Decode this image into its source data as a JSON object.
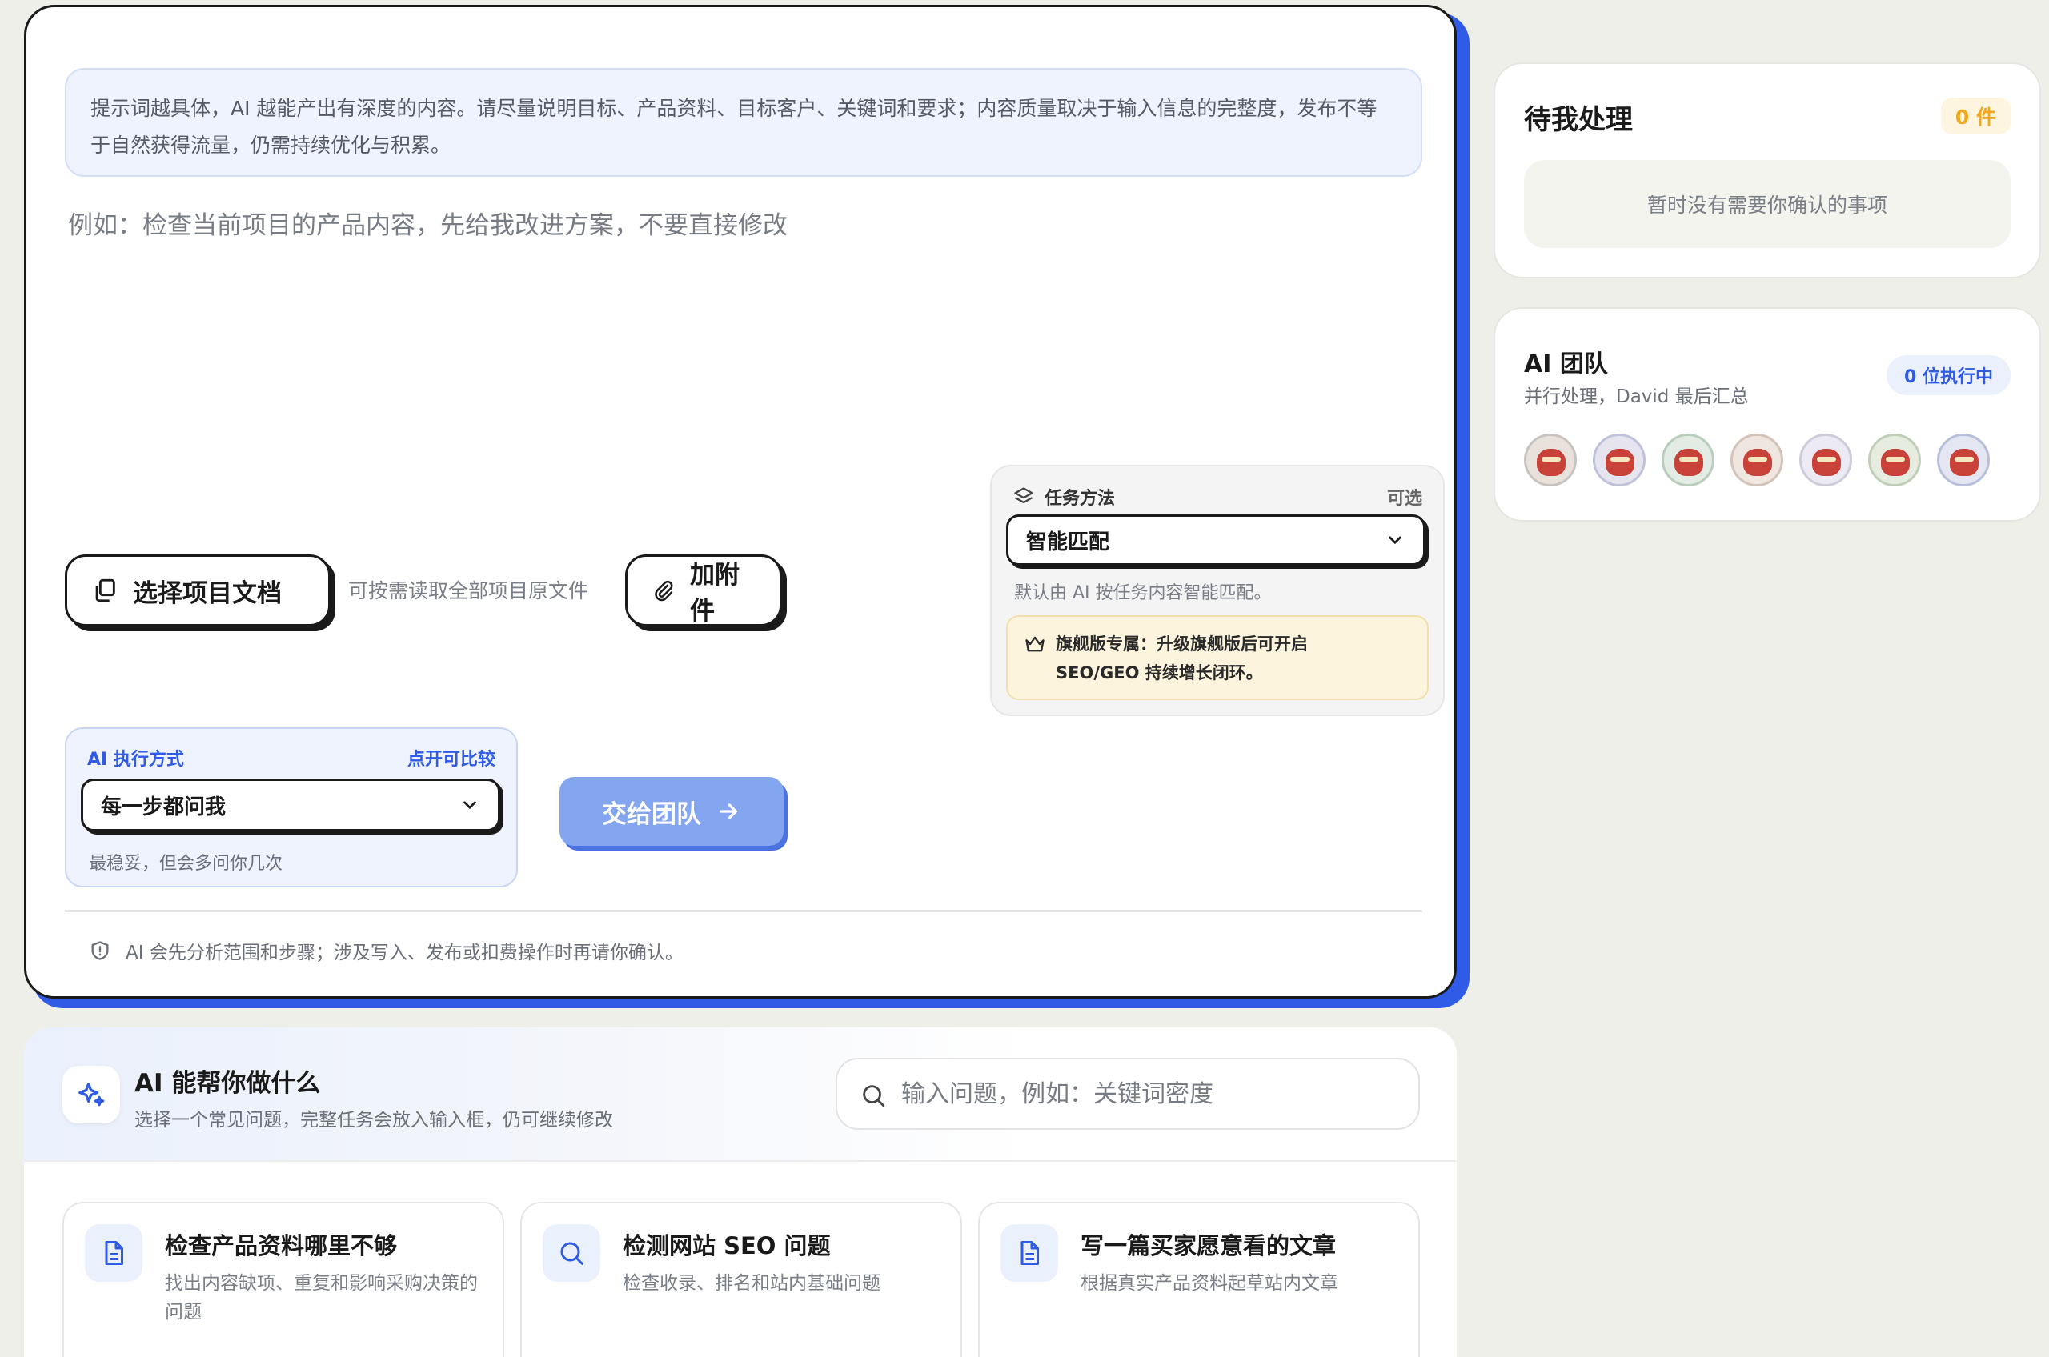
{
  "composer": {
    "hint": "提示词越具体，AI 越能产出有深度的内容。请尽量说明目标、产品资料、目标客户、关键词和要求；内容质量取决于输入信息的完整度，发布不等于自然获得流量，仍需持续优化与积累。",
    "prompt_placeholder": "例如：检查当前项目的产品内容，先给我改进方案，不要直接修改",
    "select_doc_label": "选择项目文档",
    "select_doc_hint": "可按需读取全部项目原文件",
    "attach_label": "加附件",
    "method": {
      "title": "任务方法",
      "optional": "可选",
      "selected": "智能匹配",
      "desc": "默认由 AI 按任务内容智能匹配。",
      "upsell_line1": "旗舰版专属：升级旗舰版后可开启",
      "upsell_line2": "SEO/GEO 持续增长闭环。"
    },
    "exec": {
      "title": "AI 执行方式",
      "compare": "点开可比较",
      "selected": "每一步都问我",
      "desc": "最稳妥，但会多问你几次"
    },
    "handoff_label": "交给团队",
    "notice": "AI 会先分析范围和步骤；涉及写入、发布或扣费操作时再请你确认。"
  },
  "help": {
    "title": "AI 能帮你做什么",
    "subtitle": "选择一个常见问题，完整任务会放入输入框，仍可继续修改",
    "search_placeholder": "输入问题，例如：关键词密度",
    "cards": [
      {
        "title": "检查产品资料哪里不够",
        "desc": "找出内容缺项、重复和影响采购决策的问题",
        "icon": "document-icon"
      },
      {
        "title": "检测网站 SEO 问题",
        "desc": "检查收录、排名和站内基础问题",
        "icon": "search-icon"
      },
      {
        "title": "写一篇买家愿意看的文章",
        "desc": "根据真实产品资料起草站内文章",
        "icon": "document-icon"
      }
    ]
  },
  "pending": {
    "title": "待我处理",
    "count": "0 件",
    "empty": "暂时没有需要你确认的事项"
  },
  "team": {
    "title": "AI 团队",
    "subtitle": "并行处理，David 最后汇总",
    "badge": "0 位执行中",
    "avatar_count": 7
  },
  "colors": {
    "accent": "#2f5be6",
    "accent_light": "#84a5ef",
    "warning": "#f0a81e",
    "background": "#efefe9"
  }
}
